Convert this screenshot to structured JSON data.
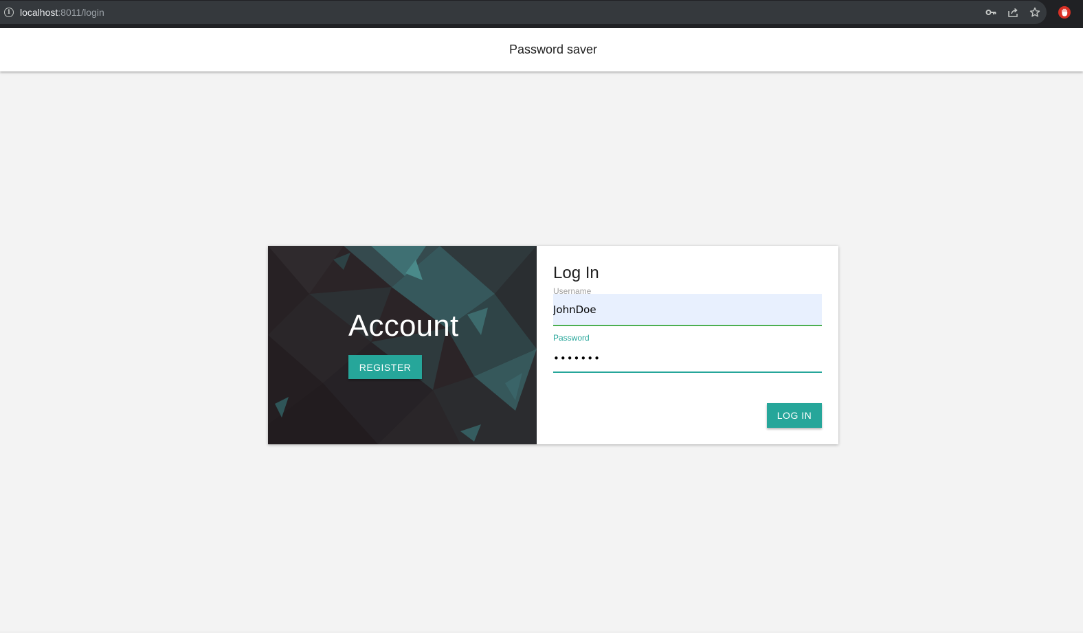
{
  "browser": {
    "url_host": "localhost",
    "url_rest": ":8011/login"
  },
  "header": {
    "title": "Password saver"
  },
  "card": {
    "left": {
      "title": "Account",
      "register_label": "REGISTER"
    },
    "right": {
      "title": "Log In",
      "username_label": "Username",
      "username_value": "JohnDoe",
      "password_label": "Password",
      "password_value": "•••••••",
      "login_label": "LOG IN"
    }
  },
  "colors": {
    "accent": "#26a69a",
    "username_underline": "#4caf50",
    "autofill_bg": "#e8f0fe"
  },
  "icons": {
    "info": "info-icon",
    "key": "key-icon",
    "share": "share-icon",
    "bookmark": "star-icon",
    "extension": "extension-hand-icon"
  }
}
